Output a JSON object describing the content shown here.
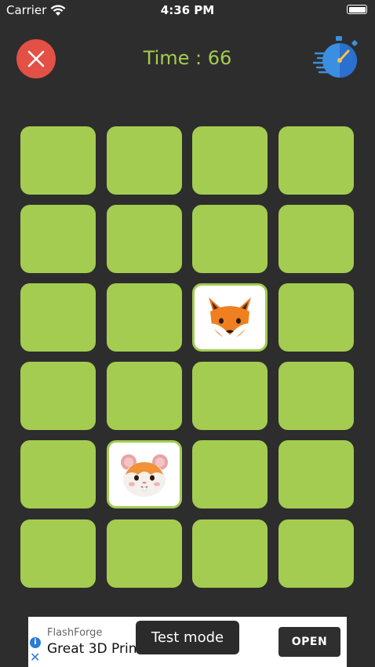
{
  "status_bar": {
    "carrier": "Carrier",
    "time": "4:36 PM"
  },
  "header": {
    "timer_text": "Time : 66",
    "close_icon": "close-icon",
    "stopwatch_icon": "stopwatch-icon"
  },
  "colors": {
    "tile": "#a4cc50",
    "background": "#2d2d2d",
    "close": "#e25046",
    "timer_text": "#a4cc50"
  },
  "board": {
    "rows": 6,
    "cols": 4,
    "revealed": [
      {
        "row": 3,
        "col": 3,
        "icon": "fox-face-icon"
      },
      {
        "row": 5,
        "col": 2,
        "icon": "hamster-face-icon"
      }
    ]
  },
  "ad": {
    "brand": "FlashForge",
    "title": "Great 3D Prin",
    "open_label": "OPEN",
    "test_mode_label": "Test mode",
    "info_glyph": "i",
    "close_glyph": "✕"
  }
}
